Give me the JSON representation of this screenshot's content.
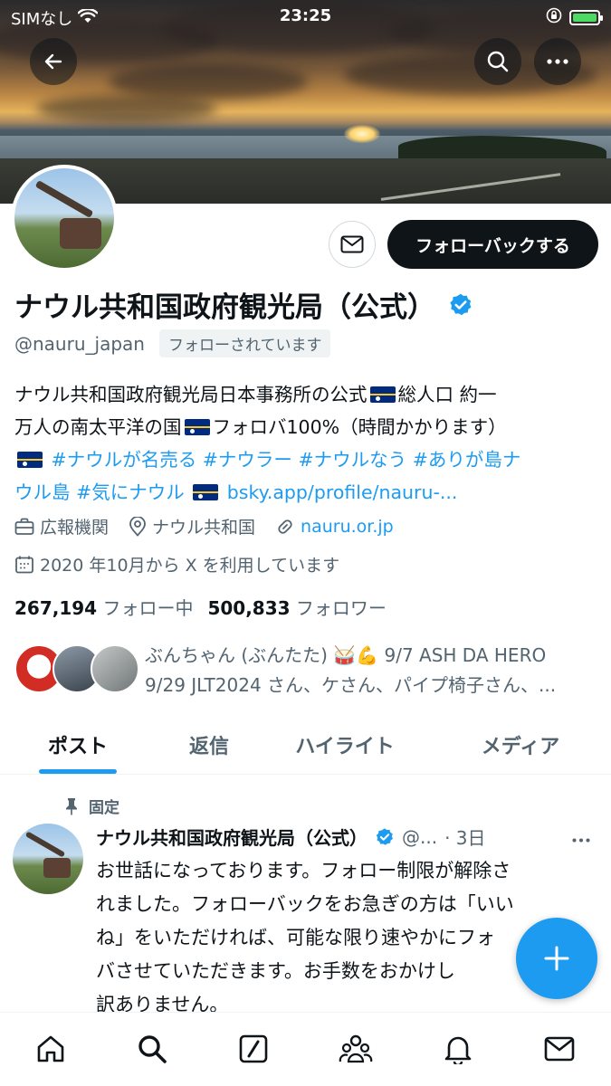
{
  "status_bar": {
    "carrier": "SIMなし",
    "time": "23:25"
  },
  "profile": {
    "name": "ナウル共和国政府観光局（公式）",
    "handle": "@nauru_japan",
    "follows_you": "フォローされています",
    "follow_back_label": "フォローバックする",
    "bio": {
      "line1": "ナウル共和国政府観光局日本事務所の公式",
      "line1b": "総人口 約一",
      "line2": "万人の南太平洋の国",
      "line2b": "フォロバ100%（時間かかります）",
      "tag1": "#ナウルが名売る",
      "tag2": "#ナウラー",
      "tag3": "#ナウルなう",
      "tag4a": "#ありが島ナ",
      "tag4b": "ウル島",
      "tag5": "#気にナウル",
      "bsky_link": "bsky.app/profile/nauru-..."
    },
    "category": "広報機関",
    "location": "ナウル共和国",
    "website": "nauru.or.jp",
    "joined": "2020 年10月から X を利用しています",
    "following_count": "267,194",
    "following_label": "フォロー中",
    "followers_count": "500,833",
    "followers_label": "フォロワー",
    "followed_by_line1": "ぶんちゃん (ぶんたた) 🥁💪 9/7 ASH DA HERO",
    "followed_by_line2": "9/29 JLT2024 さん、ケさん、パイプ椅子さん、..."
  },
  "tabs": [
    "ポスト",
    "返信",
    "ハイライト",
    "メディア"
  ],
  "pinned_tweet": {
    "pinned_label": "固定",
    "author": "ナウル共和国政府観光局（公式）",
    "handle": "@...",
    "time": "· 3日",
    "body_lines": [
      "お世話になっております。フォロー制限が解除さ",
      "れました。フォローバックをお急ぎの方は「いい",
      "ね」をいただければ、可能な限り速やかにフォ",
      "バさせていただきます。お手数をおかけし",
      "訳ありません。"
    ]
  },
  "icons": {
    "back": "back-arrow-icon",
    "search": "search-icon",
    "more": "more-icon",
    "message": "mail-icon",
    "verified": "verified-badge-icon",
    "category": "briefcase-icon",
    "location": "location-pin-icon",
    "website": "link-icon",
    "joined": "calendar-icon",
    "pin": "pin-icon",
    "compose": "plus-icon",
    "nav": [
      "home-icon",
      "search-icon",
      "grok-icon",
      "communities-icon",
      "notifications-icon",
      "messages-icon"
    ]
  },
  "colors": {
    "accent": "#1d9bf0",
    "text": "#0f1419",
    "secondary_text": "#536471",
    "button_dark": "#0f1419"
  }
}
